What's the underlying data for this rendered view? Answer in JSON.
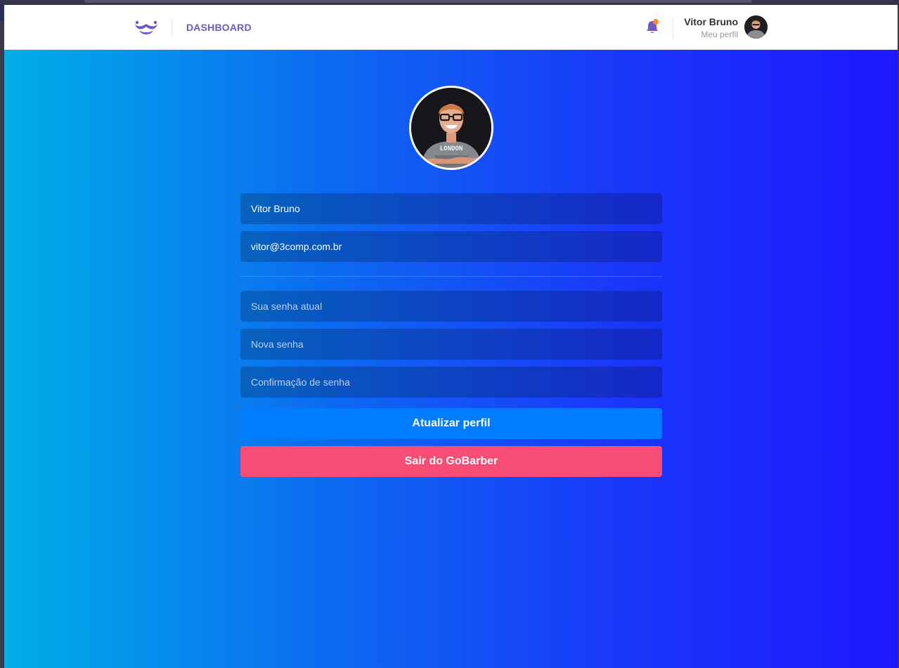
{
  "header": {
    "nav_link": "DASHBOARD",
    "user_name": "Vitor Bruno",
    "profile_link": "Meu perfil",
    "brand_color": "#7159c1",
    "notification_dot_color": "#ff892e"
  },
  "profile_form": {
    "name_value": "Vitor Bruno",
    "email_value": "vitor@3comp.com.br",
    "old_password_placeholder": "Sua senha atual",
    "new_password_placeholder": "Nova senha",
    "confirm_password_placeholder": "Confirmação de senha",
    "update_button_label": "Atualizar perfil",
    "logout_button_label": "Sair do GoBarber",
    "update_button_color": "#007dff",
    "logout_button_color": "#f64c75"
  },
  "icons": {
    "logo": "mustache-logo-icon",
    "notifications": "bell-icon"
  }
}
